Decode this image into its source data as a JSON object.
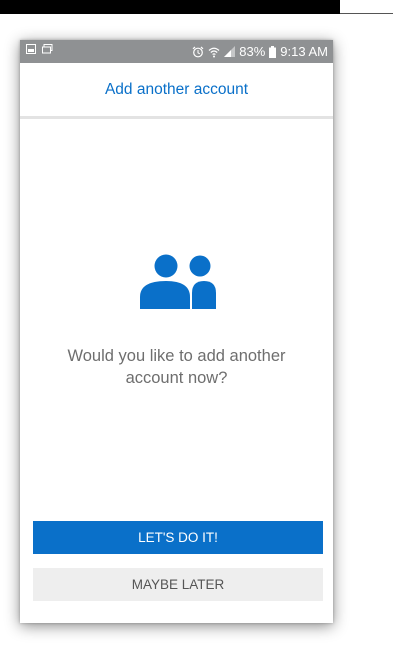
{
  "status_bar": {
    "battery": "83%",
    "time": "9:13 AM",
    "icons": [
      "gallery-icon",
      "notification-icon",
      "alarm-icon",
      "wifi-icon",
      "signal-icon",
      "battery-icon"
    ]
  },
  "header": {
    "title": "Add another account"
  },
  "main": {
    "icon": "people-icon",
    "prompt_line1": "Would you like to add another",
    "prompt_line2": "account now?"
  },
  "actions": {
    "primary_label": "LET'S DO IT!",
    "secondary_label": "MAYBE LATER"
  },
  "colors": {
    "accent": "#0a70c9",
    "status_bar": "#8f9193",
    "secondary_button": "#eeeeee"
  }
}
